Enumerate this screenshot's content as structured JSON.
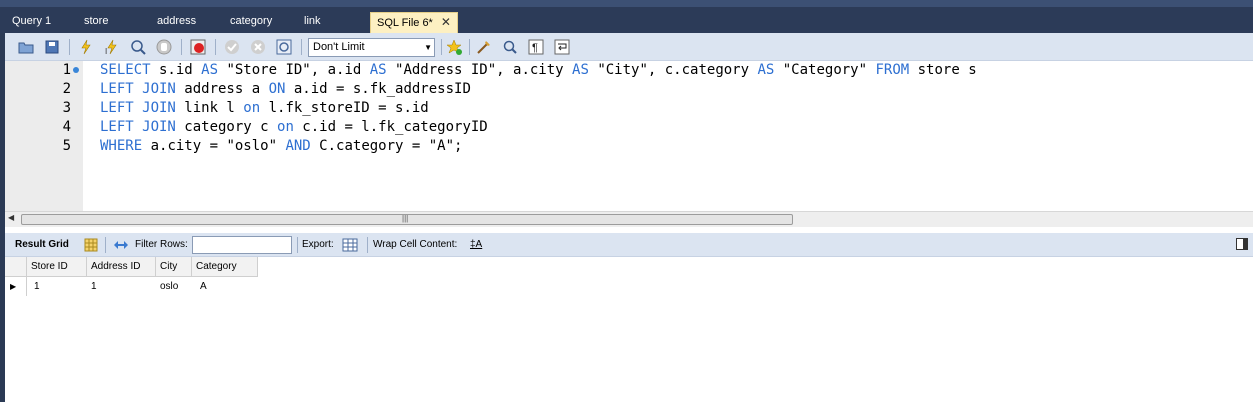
{
  "tabs": [
    {
      "label": "Query 1"
    },
    {
      "label": "store"
    },
    {
      "label": "address"
    },
    {
      "label": "category"
    },
    {
      "label": "link"
    },
    {
      "label": "SQL File 6*",
      "active": true
    }
  ],
  "toolbar": {
    "limit_value": "Don't Limit",
    "icons": [
      "open-folder-icon",
      "save-icon",
      "execute-icon",
      "execute-current-icon",
      "explain-icon",
      "stop-icon",
      "toggle-error-icon",
      "commit-icon",
      "rollback-icon",
      "autocommit-icon",
      "add-snippet-icon",
      "beautify-icon",
      "find-icon",
      "invisible-chars-icon",
      "word-wrap-icon"
    ]
  },
  "editor": {
    "line_numbers": [
      "1",
      "2",
      "3",
      "4",
      "5"
    ],
    "lines": [
      [
        {
          "t": "SELECT",
          "k": 1
        },
        {
          "t": " s.id "
        },
        {
          "t": "AS",
          "k": 1
        },
        {
          "t": " \"Store ID\", a.id "
        },
        {
          "t": "AS",
          "k": 1
        },
        {
          "t": " \"Address ID\", a.city "
        },
        {
          "t": "AS",
          "k": 1
        },
        {
          "t": " \"City\", c.category "
        },
        {
          "t": "AS",
          "k": 1
        },
        {
          "t": " \"Category\" "
        },
        {
          "t": "FROM",
          "k": 1
        },
        {
          "t": " store s"
        }
      ],
      [
        {
          "t": "LEFT JOIN",
          "k": 1
        },
        {
          "t": " address a "
        },
        {
          "t": "ON",
          "k": 1
        },
        {
          "t": " a.id = s.fk_addressID"
        }
      ],
      [
        {
          "t": "LEFT JOIN",
          "k": 1
        },
        {
          "t": " link l "
        },
        {
          "t": "on",
          "k": 1
        },
        {
          "t": " l.fk_storeID = s.id"
        }
      ],
      [
        {
          "t": "LEFT JOIN",
          "k": 1
        },
        {
          "t": " category c "
        },
        {
          "t": "on",
          "k": 1
        },
        {
          "t": " c.id = l.fk_categoryID"
        }
      ],
      [
        {
          "t": "WHERE",
          "k": 1
        },
        {
          "t": " a.city = \"oslo\" "
        },
        {
          "t": "AND",
          "k": 1
        },
        {
          "t": " C.category = \"A\";"
        }
      ]
    ]
  },
  "results": {
    "result_grid_label": "Result Grid",
    "filter_rows_label": "Filter Rows:",
    "export_label": "Export:",
    "wrap_label": "Wrap Cell Content:",
    "wrap_icon_text": "‡A",
    "columns": [
      "Store ID",
      "Address ID",
      "City",
      "Category"
    ],
    "rows": [
      [
        "1",
        "1",
        "oslo",
        "A"
      ]
    ]
  },
  "colors": {
    "keyword": "#2d6fd1",
    "active_tab": "#fdf0c2",
    "toolbar": "#dbe4f1"
  }
}
